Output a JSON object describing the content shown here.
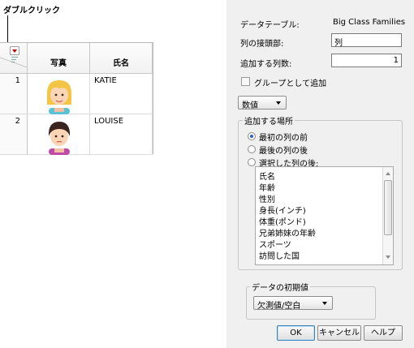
{
  "annotation": {
    "callout": "ダブルクリック"
  },
  "table": {
    "columns": [
      "写真",
      "氏名"
    ],
    "rows": [
      {
        "num": "1",
        "name": "KATIE",
        "photo": "girl-blonde-avatar"
      },
      {
        "num": "2",
        "name": "LOUISE",
        "photo": "girl-dark-hair-avatar"
      }
    ]
  },
  "dialog": {
    "data_table_label": "データテーブル:",
    "data_table_value": "Big Class Families",
    "prefix_label": "列の接頭部:",
    "prefix_value": "列",
    "count_label": "追加する列数:",
    "count_value": "1",
    "group_checkbox_label": "グループとして追加",
    "type_select": "数値",
    "location_title": "追加する場所",
    "location_options": [
      "最初の列の前",
      "最後の列の後",
      "選択した列の後:"
    ],
    "column_list": [
      "氏名",
      "年齢",
      "性別",
      "身長(インチ)",
      "体重(ポンド)",
      "兄弟姉妹の年齢",
      "スポーツ",
      "訪問した国"
    ],
    "initial_title": "データの初期値",
    "initial_select": "欠測値/空白",
    "ok": "OK",
    "cancel": "キャンセル",
    "help": "ヘルプ"
  },
  "colors": {
    "radio_selected": "#2d5db8",
    "menu_arrow": "#c00000",
    "default_button_border": "#3c7fb1"
  }
}
